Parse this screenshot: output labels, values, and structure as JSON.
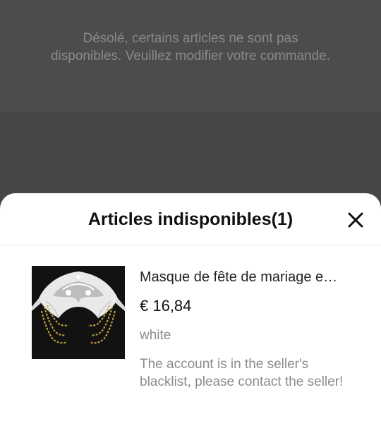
{
  "background": {
    "message": "Désolé, certains articles ne sont pas disponibles. Veuillez modifier votre commande."
  },
  "sheet": {
    "title": "Articles indisponibles(1)",
    "close_icon": "close-icon"
  },
  "items": [
    {
      "name": "Masque de fête de mariage e…",
      "price": "€ 16,84",
      "variant": "white",
      "reason": "The account is in the seller's blacklist, please contact the seller!",
      "image_icon": "lace-mask-image"
    }
  ],
  "colors": {
    "overlay": "#4a4a4a",
    "sheet": "#ffffff",
    "title": "#111111",
    "muted_text": "#8c8c8c"
  }
}
